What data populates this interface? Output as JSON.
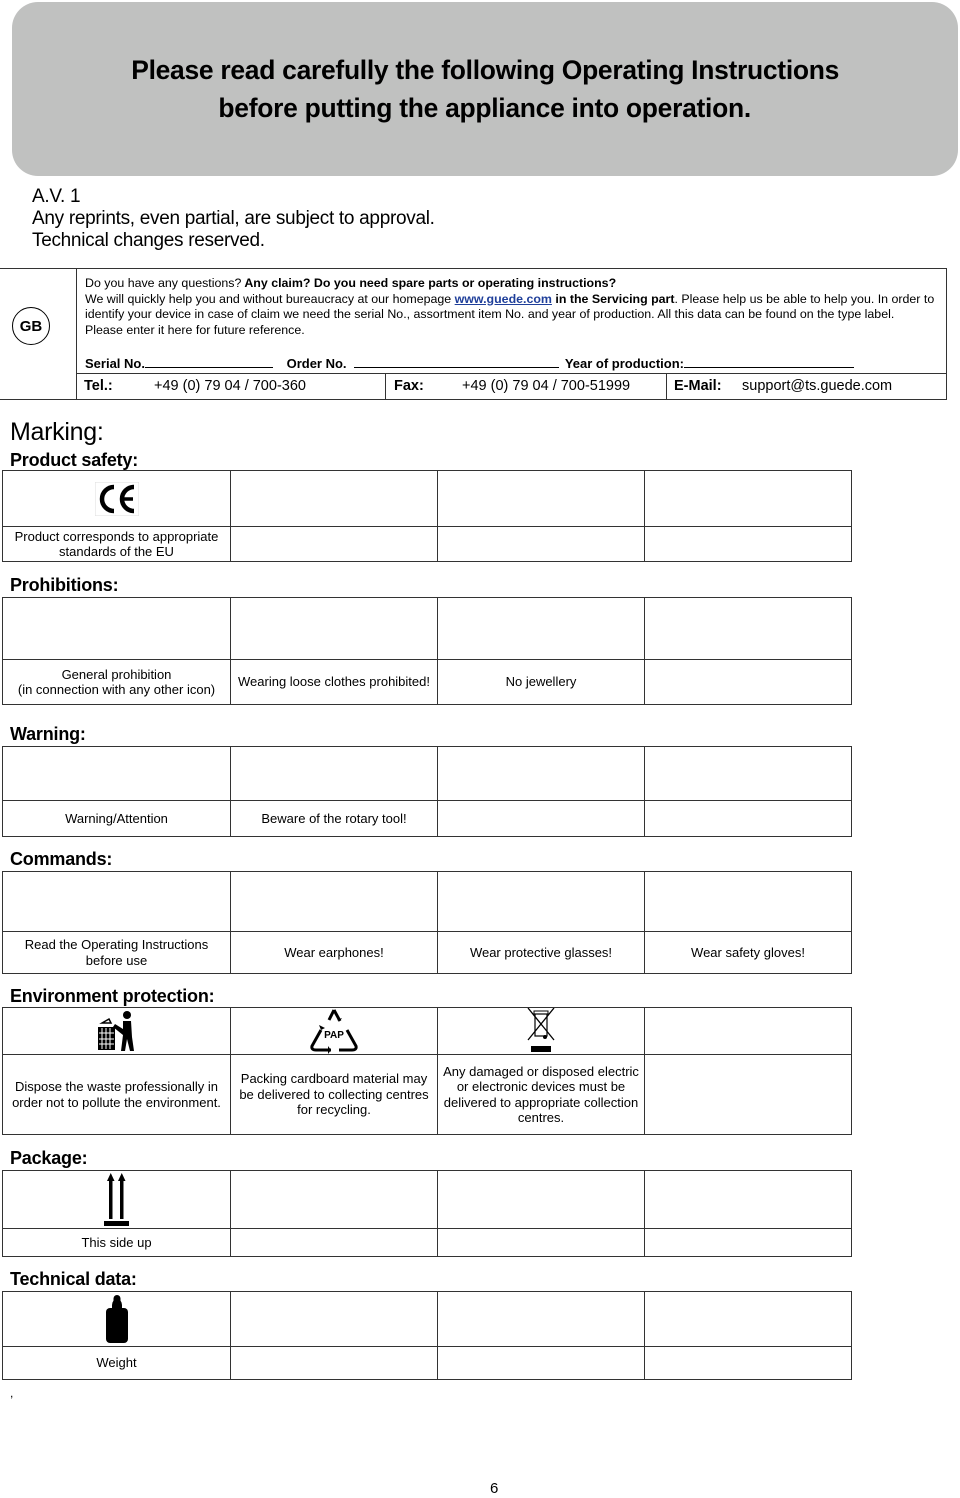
{
  "banner": {
    "line1": "Please read carefully the following Operating Instructions",
    "line2": "before putting the appliance into operation."
  },
  "meta": {
    "version": "A.V. 1",
    "reprints": "Any reprints, even partial, are subject to approval.",
    "changes": "Technical changes reserved."
  },
  "info": {
    "country_badge": "GB",
    "q_plain": "Do you have any questions?",
    "q_bold": " Any claim? Do you need spare parts or operating instructions?",
    "help_pre": "We will quickly help you and without bureaucracy at our homepage ",
    "homepage_link": "www.guede.com",
    "help_bold": " in the Servicing part",
    "help_post": ". Please help us be able to help you. In order to identify your device in case of claim we need the serial No., assortment item No. and year of production. All this data can be found on the type label. Please enter it here for future reference.",
    "serial_label": "Serial No.",
    "order_label": "Order No.",
    "year_label": "Year of production:",
    "tel_label": "Tel.:",
    "tel_value": "+49 (0) 79 04 / 700-360",
    "fax_label": "Fax:",
    "fax_value": "+49 (0) 79 04 / 700-51999",
    "email_label": "E-Mail:",
    "email_value": "support@ts.guede.com",
    "link_color": "#1f3f9a"
  },
  "sections": {
    "marking": "Marking:",
    "product_safety": {
      "title": "Product safety:",
      "labels": [
        "Product corresponds to appropriate standards of the EU",
        "",
        "",
        ""
      ]
    },
    "prohibitions": {
      "title": "Prohibitions:",
      "labels": [
        "General prohibition\n(in connection with any other icon)",
        "Wearing loose clothes prohibited!",
        "No jewellery",
        ""
      ]
    },
    "warning": {
      "title": "Warning:",
      "labels": [
        "Warning/Attention",
        "Beware of the rotary tool!",
        "",
        ""
      ]
    },
    "commands": {
      "title": "Commands:",
      "labels": [
        "Read the Operating Instructions before use",
        "Wear earphones!",
        "Wear protective glasses!",
        "Wear safety gloves!"
      ]
    },
    "environment": {
      "title": "Environment protection:",
      "labels": [
        "Dispose the waste professionally in order not to pollute the environment.",
        "Packing cardboard material may be delivered to collecting centres for recycling.",
        "Any damaged or disposed electric or electronic devices must be delivered to appropriate collection centres.",
        ""
      ],
      "pap_text": "PAP"
    },
    "package": {
      "title": "Package:",
      "labels": [
        "This side up",
        "",
        "",
        ""
      ]
    },
    "technical": {
      "title": "Technical data:",
      "labels": [
        "Weight",
        "",
        "",
        ""
      ]
    }
  },
  "footer": {
    "stray_mark": ",",
    "page_number": "6"
  }
}
